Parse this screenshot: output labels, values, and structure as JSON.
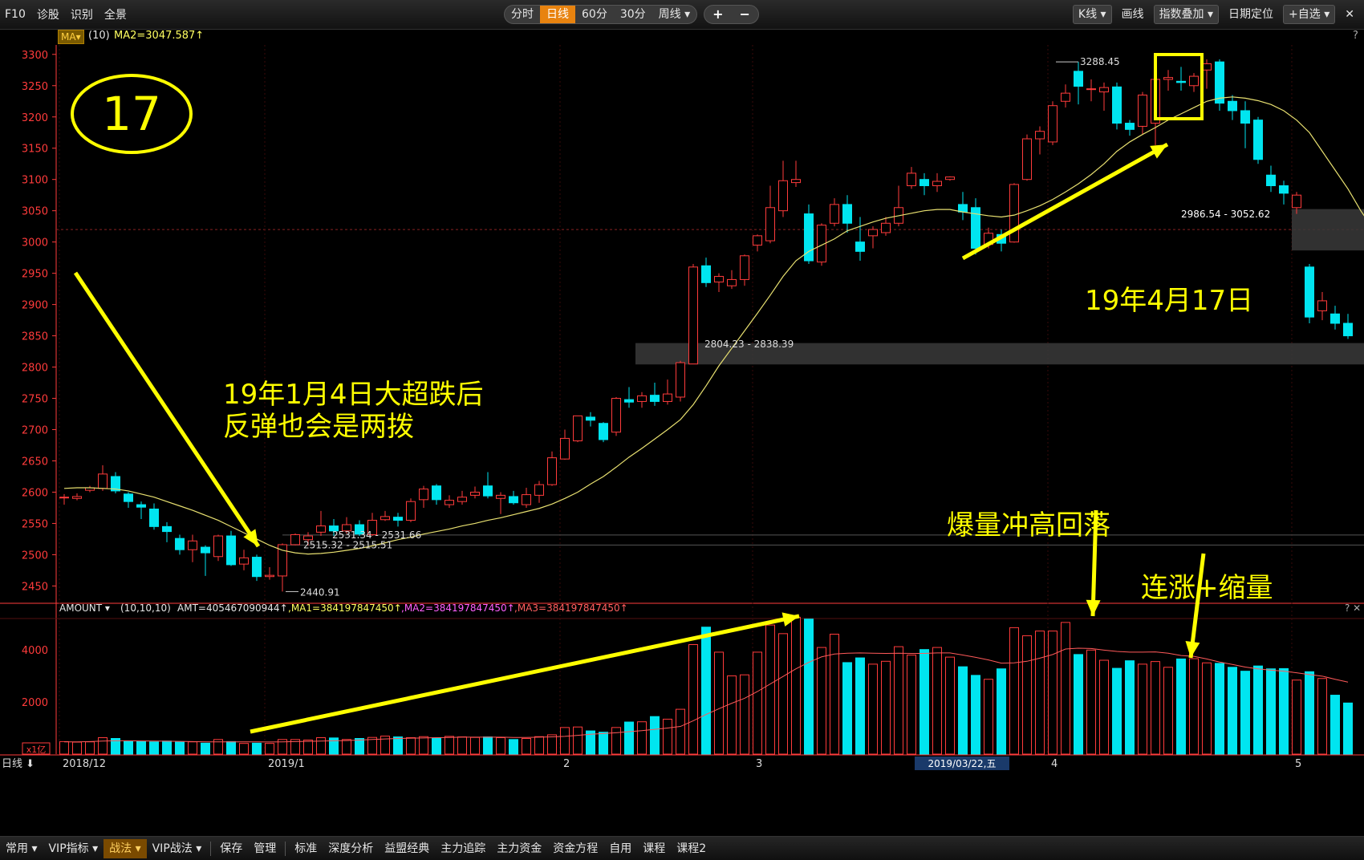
{
  "topbar": {
    "left": [
      "F10",
      "诊股",
      "识别",
      "全景"
    ],
    "periods": [
      "分时",
      "日线",
      "60分",
      "30分",
      "周线 ▾"
    ],
    "active_period": "日线",
    "zoom": [
      "+",
      "−"
    ],
    "right": {
      "kline": "K线 ▾",
      "draw": "画线",
      "overlay": "指数叠加 ▾",
      "date_locate": "日期定位",
      "watch": "+自选 ▾",
      "close": "✕"
    }
  },
  "infobar": {
    "ma_tag": "MA▾",
    "params": "(10)",
    "ma2": "MA2=3047.587↑",
    "help": "?"
  },
  "volume_header": {
    "label": "AMOUNT ▾",
    "params": "(10,10,10)",
    "amt": "AMT=405467090944↑",
    "ma1": ",MA1=384197847450↑",
    "ma2": ",MA2=384197847450↑",
    "ma3": ",MA3=384197847450↑",
    "help": "? ✕"
  },
  "price_axis": [
    "3300",
    "3250",
    "3200",
    "3150",
    "3100",
    "3050",
    "3000",
    "2950",
    "2900",
    "2850",
    "2800",
    "2750",
    "2700",
    "2650",
    "2600",
    "2550",
    "2500",
    "2450"
  ],
  "vol_axis": [
    "4000",
    "2000"
  ],
  "vol_unit": "x1亿",
  "x_labels": [
    {
      "text": "日线 ⬇",
      "idx": -3
    },
    {
      "text": "2018/12",
      "idx": 0
    },
    {
      "text": "2019/1",
      "idx": 16
    },
    {
      "text": "2",
      "idx": 39
    },
    {
      "text": "3",
      "idx": 54
    },
    {
      "text": "4",
      "idx": 77
    },
    {
      "text": "5",
      "idx": 96
    }
  ],
  "date_highlight": "2019/03/22,五",
  "annotations": {
    "circle_number": "17",
    "text1_line1": "19年1月4日大超跌后",
    "text1_line2": "反弹也会是两拨",
    "text2": "19年4月17日",
    "text3": "爆量冲高回落",
    "text4": "连涨+缩量"
  },
  "price_labels": {
    "high": "3288.45",
    "low": "2440.91",
    "gap1": "2986.54 - 3052.62",
    "gap2": "2804.23 - 2838.39",
    "gap3a": "2531.34 - 2531.66",
    "gap3b": "2515.32 - 2515.51"
  },
  "colors": {
    "up": "#ff3b3b",
    "down": "#00e5f0",
    "ma": "#e8e070",
    "annot": "#ffff00",
    "axis": "#ff3b3b",
    "bg": "#000000"
  },
  "chart_data": {
    "type": "candlestick",
    "ylim": [
      2430,
      3310
    ],
    "candles": [
      [
        2591,
        2592,
        2580,
        2597
      ],
      [
        2590,
        2593,
        2587,
        2598
      ],
      [
        2603,
        2607,
        2600,
        2610
      ],
      [
        2606,
        2629,
        2602,
        2643
      ],
      [
        2625,
        2602,
        2598,
        2632
      ],
      [
        2597,
        2585,
        2575,
        2600
      ],
      [
        2580,
        2576,
        2557,
        2585
      ],
      [
        2573,
        2545,
        2540,
        2582
      ],
      [
        2545,
        2537,
        2520,
        2552
      ],
      [
        2526,
        2508,
        2500,
        2532
      ],
      [
        2508,
        2522,
        2488,
        2532
      ],
      [
        2512,
        2503,
        2466,
        2515
      ],
      [
        2497,
        2530,
        2490,
        2532
      ],
      [
        2530,
        2484,
        2482,
        2538
      ],
      [
        2485,
        2495,
        2475,
        2508
      ],
      [
        2496,
        2465,
        2458,
        2500
      ],
      [
        2465,
        2467,
        2460,
        2480
      ],
      [
        2466,
        2516,
        2441,
        2518
      ],
      [
        2516,
        2532,
        2515,
        2534
      ],
      [
        2524,
        2530,
        2515,
        2536
      ],
      [
        2536,
        2546,
        2530,
        2570
      ],
      [
        2546,
        2538,
        2530,
        2557
      ],
      [
        2538,
        2548,
        2534,
        2560
      ],
      [
        2548,
        2533,
        2530,
        2555
      ],
      [
        2532,
        2555,
        2530,
        2567
      ],
      [
        2556,
        2561,
        2554,
        2570
      ],
      [
        2560,
        2555,
        2545,
        2567
      ],
      [
        2555,
        2585,
        2552,
        2590
      ],
      [
        2588,
        2605,
        2575,
        2610
      ],
      [
        2610,
        2588,
        2580,
        2613
      ],
      [
        2580,
        2587,
        2575,
        2595
      ],
      [
        2585,
        2592,
        2580,
        2602
      ],
      [
        2595,
        2600,
        2590,
        2609
      ],
      [
        2610,
        2594,
        2590,
        2632
      ],
      [
        2590,
        2595,
        2565,
        2600
      ],
      [
        2593,
        2583,
        2580,
        2602
      ],
      [
        2580,
        2596,
        2575,
        2607
      ],
      [
        2595,
        2612,
        2583,
        2618
      ],
      [
        2612,
        2655,
        2610,
        2665
      ],
      [
        2653,
        2686,
        2652,
        2700
      ],
      [
        2682,
        2722,
        2680,
        2722
      ],
      [
        2720,
        2715,
        2705,
        2728
      ],
      [
        2710,
        2684,
        2680,
        2712
      ],
      [
        2696,
        2750,
        2690,
        2752
      ],
      [
        2748,
        2744,
        2735,
        2768
      ],
      [
        2745,
        2754,
        2735,
        2760
      ],
      [
        2755,
        2745,
        2738,
        2775
      ],
      [
        2745,
        2757,
        2740,
        2780
      ],
      [
        2752,
        2807,
        2745,
        2810
      ],
      [
        2805,
        2960,
        2805,
        2965
      ],
      [
        2962,
        2935,
        2928,
        2975
      ],
      [
        2936,
        2945,
        2920,
        2950
      ],
      [
        2930,
        2940,
        2925,
        2955
      ],
      [
        2940,
        2978,
        2930,
        2980
      ],
      [
        2995,
        3010,
        2985,
        3012
      ],
      [
        3002,
        3055,
        2998,
        3090
      ],
      [
        3050,
        3098,
        3040,
        3130
      ],
      [
        3095,
        3100,
        3088,
        3130
      ],
      [
        3045,
        2970,
        2965,
        3060
      ],
      [
        2968,
        3027,
        2962,
        3030
      ],
      [
        3030,
        3060,
        3025,
        3070
      ],
      [
        3060,
        3030,
        3015,
        3075
      ],
      [
        3000,
        2985,
        2970,
        3040
      ],
      [
        3010,
        3020,
        2990,
        3025
      ],
      [
        3015,
        3030,
        3010,
        3040
      ],
      [
        3030,
        3055,
        3025,
        3090
      ],
      [
        3090,
        3110,
        3085,
        3120
      ],
      [
        3100,
        3090,
        3075,
        3110
      ],
      [
        3090,
        3097,
        3080,
        3110
      ],
      [
        3100,
        3104,
        3098,
        3105
      ],
      [
        3060,
        3048,
        3035,
        3080
      ],
      [
        3055,
        2990,
        2980,
        3070
      ],
      [
        2996,
        3014,
        2990,
        3023
      ],
      [
        3012,
        2998,
        2985,
        3020
      ],
      [
        3000,
        3092,
        2999,
        3094
      ],
      [
        3100,
        3165,
        3098,
        3172
      ],
      [
        3165,
        3177,
        3140,
        3185
      ],
      [
        3160,
        3218,
        3155,
        3225
      ],
      [
        3225,
        3238,
        3215,
        3252
      ],
      [
        3273,
        3249,
        3220,
        3288
      ],
      [
        3245,
        3245,
        3225,
        3260
      ],
      [
        3240,
        3247,
        3210,
        3255
      ],
      [
        3248,
        3190,
        3180,
        3255
      ],
      [
        3190,
        3180,
        3170,
        3195
      ],
      [
        3185,
        3235,
        3172,
        3240
      ],
      [
        3190,
        3260,
        3155,
        3270
      ],
      [
        3260,
        3263,
        3242,
        3275
      ],
      [
        3257,
        3255,
        3242,
        3280
      ],
      [
        3250,
        3265,
        3240,
        3270
      ],
      [
        3275,
        3285,
        3245,
        3292
      ],
      [
        3288,
        3222,
        3210,
        3292
      ],
      [
        3225,
        3210,
        3195,
        3235
      ],
      [
        3210,
        3190,
        3150,
        3225
      ],
      [
        3195,
        3132,
        3125,
        3200
      ],
      [
        3107,
        3090,
        3080,
        3122
      ],
      [
        3090,
        3078,
        3060,
        3098
      ],
      [
        3055,
        3075,
        3045,
        3080
      ],
      [
        2960,
        2880,
        2870,
        2965
      ],
      [
        2890,
        2906,
        2875,
        2920
      ],
      [
        2885,
        2870,
        2860,
        2898
      ],
      [
        2870,
        2850,
        2845,
        2885
      ]
    ],
    "ma": [
      2606,
      2607,
      2607,
      2606,
      2605,
      2602,
      2597,
      2592,
      2585,
      2578,
      2571,
      2563,
      2555,
      2545,
      2535,
      2525,
      2515,
      2507,
      2503,
      2501,
      2502,
      2504,
      2507,
      2510,
      2514,
      2519,
      2524,
      2528,
      2533,
      2537,
      2541,
      2546,
      2550,
      2555,
      2559,
      2564,
      2569,
      2574,
      2581,
      2590,
      2600,
      2613,
      2625,
      2640,
      2656,
      2670,
      2685,
      2700,
      2716,
      2740,
      2770,
      2802,
      2830,
      2858,
      2886,
      2915,
      2945,
      2970,
      2985,
      2995,
      3005,
      3018,
      3025,
      3032,
      3038,
      3042,
      3046,
      3050,
      3052,
      3052,
      3048,
      3045,
      3042,
      3040,
      3043,
      3050,
      3058,
      3068,
      3080,
      3093,
      3108,
      3125,
      3145,
      3160,
      3172,
      3183,
      3195,
      3205,
      3215,
      3225,
      3230,
      3232,
      3230,
      3226,
      3220,
      3210,
      3195,
      3175,
      3145,
      3115,
      3085,
      3050,
      3020
    ],
    "volume": [
      480,
      460,
      470,
      630,
      600,
      490,
      480,
      470,
      500,
      460,
      470,
      420,
      560,
      480,
      410,
      420,
      410,
      560,
      560,
      540,
      630,
      620,
      560,
      600,
      640,
      690,
      660,
      630,
      670,
      620,
      680,
      660,
      640,
      660,
      630,
      560,
      600,
      670,
      740,
      1020,
      1040,
      890,
      840,
      1020,
      1230,
      1240,
      1440,
      1340,
      1720,
      4200,
      4870,
      3910,
      3000,
      3040,
      3910,
      4950,
      4620,
      5250,
      5180,
      4090,
      4600,
      3510,
      3690,
      3450,
      3560,
      4120,
      3800,
      4010,
      4090,
      3720,
      3350,
      3020,
      2870,
      3270,
      4850,
      4540,
      4720,
      4720,
      5050,
      3820,
      3990,
      3600,
      3290,
      3580,
      3450,
      3550,
      3330,
      3650,
      3660,
      3500,
      3480,
      3330,
      3180,
      3380,
      3270,
      3280,
      2840,
      3160,
      2900,
      2260,
      1960
    ],
    "volume_ma": [
      470,
      470,
      480,
      500,
      510,
      510,
      505,
      500,
      495,
      490,
      480,
      470,
      470,
      470,
      470,
      470,
      465,
      470,
      480,
      490,
      500,
      510,
      520,
      540,
      560,
      580,
      600,
      610,
      620,
      630,
      640,
      650,
      650,
      650,
      650,
      640,
      640,
      650,
      660,
      680,
      720,
      760,
      790,
      820,
      860,
      900,
      950,
      1000,
      1060,
      1280,
      1520,
      1740,
      1950,
      2140,
      2400,
      2690,
      2980,
      3270,
      3520,
      3730,
      3840,
      3870,
      3880,
      3870,
      3860,
      3870,
      3860,
      3860,
      3880,
      3880,
      3800,
      3710,
      3610,
      3490,
      3500,
      3560,
      3680,
      3820,
      4030,
      4060,
      4050,
      3990,
      3940,
      3910,
      3910,
      3920,
      3870,
      3780,
      3750,
      3650,
      3530,
      3440,
      3340,
      3270,
      3220,
      3180,
      3120,
      3050,
      2990,
      2870,
      2760
    ]
  }
}
